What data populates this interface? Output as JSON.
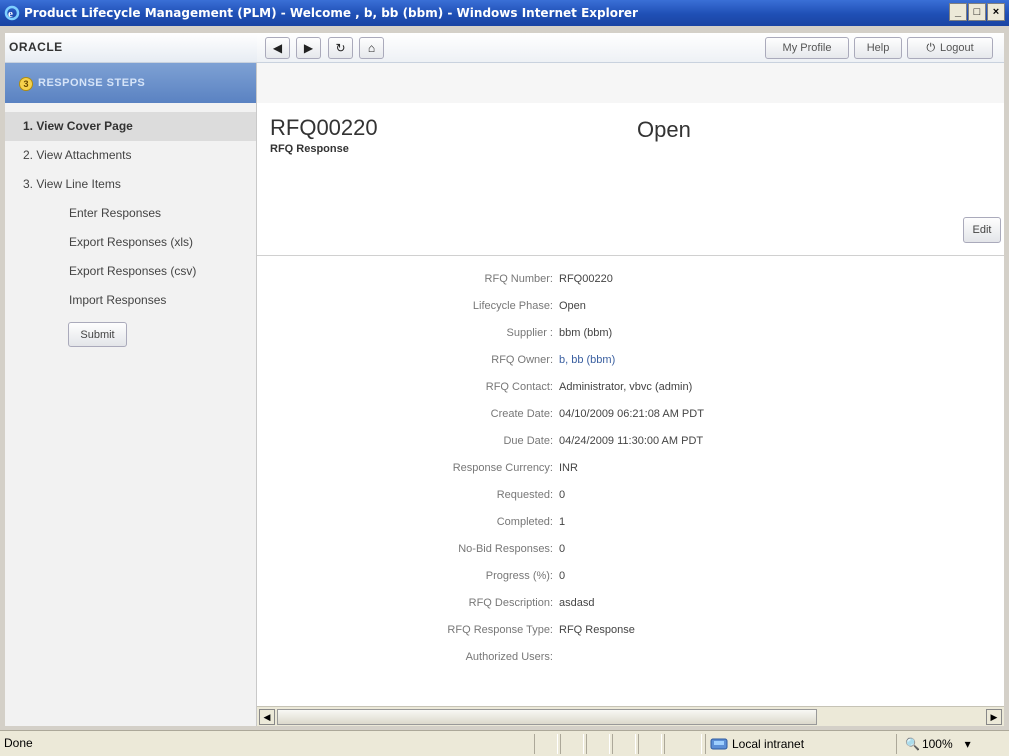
{
  "window": {
    "title": "Product Lifecycle Management (PLM) - Welcome , b, bb (bbm) - Windows Internet Explorer",
    "controls": {
      "minimize": "_",
      "maximize": "□",
      "close": "×"
    }
  },
  "header": {
    "logo": "ORACLE",
    "nav": {
      "back": "◀",
      "forward": "▶",
      "refresh": "↻",
      "home": "⌂"
    },
    "my_profile": "My Profile",
    "help": "Help",
    "logout": "Logout"
  },
  "sidebar": {
    "steps_badge": "3",
    "steps_title": "RESPONSE STEPS",
    "items": [
      {
        "label": "1. View Cover Page"
      },
      {
        "label": "2. View Attachments"
      },
      {
        "label": "3. View Line Items"
      }
    ],
    "sub_items": [
      {
        "label": "Enter Responses"
      },
      {
        "label": "Export Responses (xls)"
      },
      {
        "label": "Export Responses (csv)"
      },
      {
        "label": "Import Responses"
      }
    ],
    "submit": "Submit"
  },
  "main": {
    "rfq_id": "RFQ00220",
    "subtitle": "RFQ Response",
    "status": "Open",
    "edit": "Edit",
    "fields": [
      {
        "label": "RFQ Number:",
        "value": "RFQ00220"
      },
      {
        "label": "Lifecycle Phase:",
        "value": "Open"
      },
      {
        "label": "Supplier :",
        "value": "bbm (bbm)"
      },
      {
        "label": "RFQ Owner:",
        "value": "b, bb (bbm)"
      },
      {
        "label": "RFQ Contact:",
        "value": "Administrator, vbvc (admin)"
      },
      {
        "label": "Create Date:",
        "value": "04/10/2009 06:21:08 AM PDT"
      },
      {
        "label": "Due Date:",
        "value": "04/24/2009 11:30:00 AM PDT"
      },
      {
        "label": "Response Currency:",
        "value": "INR"
      },
      {
        "label": "Requested:",
        "value": "0"
      },
      {
        "label": "Completed:",
        "value": "1"
      },
      {
        "label": "No-Bid Responses:",
        "value": "0"
      },
      {
        "label": "Progress (%):",
        "value": "0"
      },
      {
        "label": "RFQ Description:",
        "value": "asdasd"
      },
      {
        "label": "RFQ Response Type:",
        "value": "RFQ Response"
      },
      {
        "label": "Authorized Users:",
        "value": ""
      }
    ]
  },
  "scrollbar": {
    "left": "◀",
    "right": "▶"
  },
  "statusbar": {
    "text": "Done",
    "zone": "Local intranet",
    "zoom": "100%",
    "zoom_caret": "▾"
  },
  "colors": {
    "title_bar": "#1f4fb5",
    "steps_header": "#6a8fcb",
    "link": "#3a5fa0"
  }
}
